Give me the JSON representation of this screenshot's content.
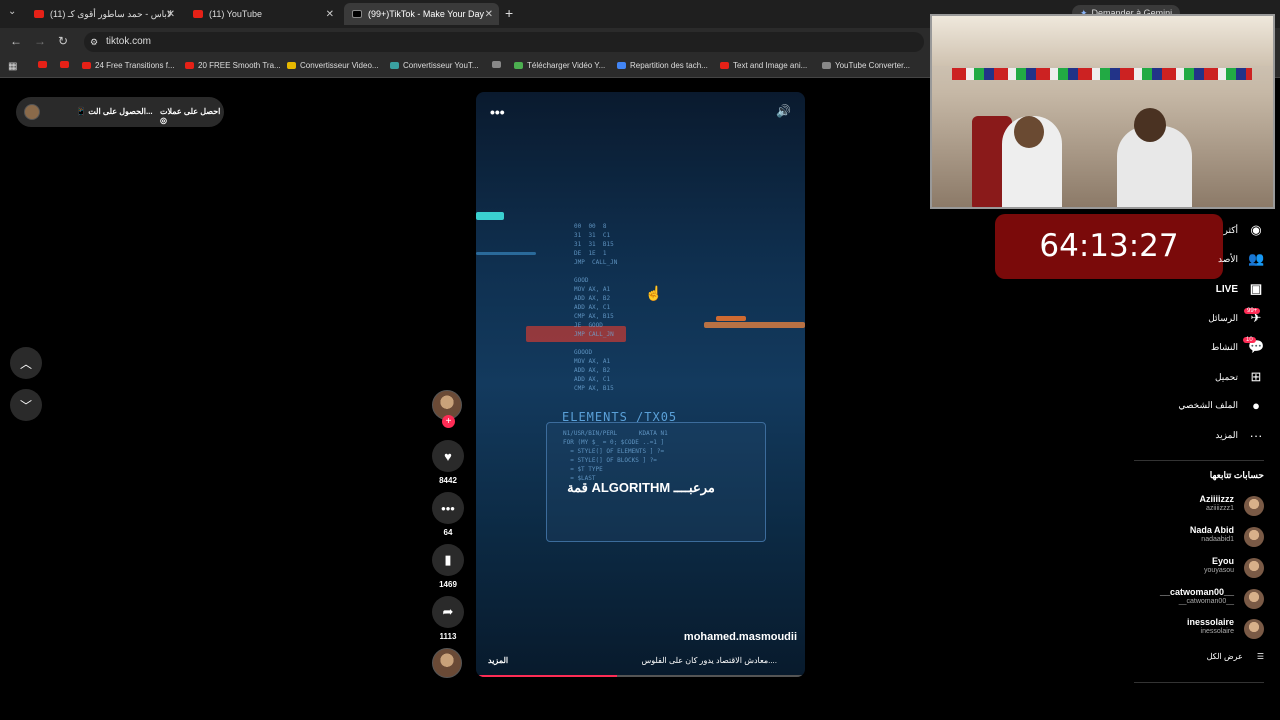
{
  "browser": {
    "tabs": [
      {
        "title": "(11) لاباس - حمد ساطور أقوى كـ",
        "active": false
      },
      {
        "title": "(11) YouTube",
        "active": false
      },
      {
        "title": "(99+)TikTok - Make Your Day",
        "active": true
      }
    ],
    "gemini_label": "Demander à Gemini",
    "url": "tiktok.com",
    "bookmarks": [
      {
        "label": "",
        "color": "#e62117"
      },
      {
        "label": "",
        "color": "#e62117"
      },
      {
        "label": "24 Free Transitions f...",
        "color": "#e62117"
      },
      {
        "label": "20 FREE Smooth Tra...",
        "color": "#e62117"
      },
      {
        "label": "Convertisseur Video...",
        "color": "#e6b800"
      },
      {
        "label": "Convertisseur YouT...",
        "color": "#3aa0a0"
      },
      {
        "label": "",
        "color": "#888888"
      },
      {
        "label": "Télécharger Vidéo Y...",
        "color": "#4caf50"
      },
      {
        "label": "Repartition des tach...",
        "color": "#4285f4"
      },
      {
        "label": "Text and Image ani...",
        "color": "#e62117"
      },
      {
        "label": "YouTube Converter...",
        "color": "#888888"
      },
      {
        "label": "",
        "color": "#e62117"
      }
    ]
  },
  "promo": {
    "coins": "احصل على عملات",
    "app": "الحصول على الت..."
  },
  "video": {
    "elements_text": "ELEMENTS /TX05",
    "caption": "قمة ALGORITHM مرعبــــ",
    "username": "mohamed.masmoudii",
    "description": "معادش الاقتصاد يدور كان على الفلوس....",
    "more": "المزيد",
    "progress": 0.43,
    "code_left": "00  00  8\n31  31  C1\n31  31  B15\nDE  1E  1\nJMP  CALL_JN\n\nGOOD\nMOV AX, A1\nADD AX, B2\nADD AX, C1\nCMP AX, B15\nJE  GOOD\nJMP CALL_JN\n\nGOOOD\nMOV AX, A1\nADD AX, B2\nADD AX, C1\nCMP AX, B15",
    "code_panel": "N1/USR/BIN/PERL      KDATA N1\nFOR (MY $_ = 0; $CODE ..=1 ]\n  = STYLE(] OF ELEMENTS ] ?=\n  = STYLE(] OF BLOCKS ] ?=\n  = $T TYPE\n  = $LAST"
  },
  "actions": {
    "likes": "8442",
    "comments": "64",
    "saves": "1469",
    "shares": "1113"
  },
  "timer": "64:13:27",
  "sidebar": {
    "nav": [
      {
        "label": "أكثر",
        "icon": "home-icon"
      },
      {
        "label": "الأصد",
        "icon": "friends-icon"
      },
      {
        "label": "LIVE",
        "icon": "live-icon"
      },
      {
        "label": "الرسائل",
        "icon": "messages-icon",
        "badge": "99+"
      },
      {
        "label": "النشاط",
        "icon": "activity-icon",
        "badge": "10"
      },
      {
        "label": "تحميل",
        "icon": "upload-icon"
      },
      {
        "label": "الملف الشخصي",
        "icon": "profile-icon"
      },
      {
        "label": "المزيد",
        "icon": "more-icon"
      }
    ],
    "following_title": "حسابات تتابعها",
    "following": [
      {
        "name": "Aziiiizzz",
        "handle": "aziiiizzz1"
      },
      {
        "name": "Nada Abid",
        "handle": "nadaabid1"
      },
      {
        "name": "Eyou",
        "handle": "youyasou"
      },
      {
        "name": "__catwoman00__",
        "handle": "__catwoman00__"
      },
      {
        "name": "inessolaire",
        "handle": "inessolaire"
      }
    ],
    "see_all": "عرض الكل"
  }
}
